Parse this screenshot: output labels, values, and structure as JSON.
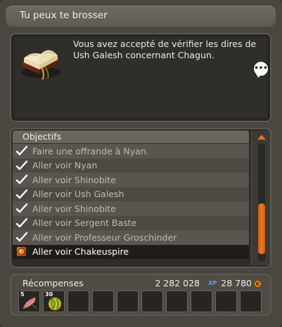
{
  "window": {
    "title": "Tu peux te brosser"
  },
  "description": {
    "text": "Vous avez accepté de vérifier les dires de Ush Galesh concernant Chagun.",
    "chat_bubble": "•••"
  },
  "objectives": {
    "header": "Objectifs",
    "items": [
      {
        "label": "Faire une offrande à Nyan.",
        "status": "done"
      },
      {
        "label": "Aller voir Nyan",
        "status": "done"
      },
      {
        "label": "Aller voir Shinobite",
        "status": "done"
      },
      {
        "label": "Aller voir Ush Galesh",
        "status": "done"
      },
      {
        "label": "Aller voir Shinobite",
        "status": "done"
      },
      {
        "label": "Aller voir Sergent Baste",
        "status": "done"
      },
      {
        "label": "Aller voir Professeur Groschinder",
        "status": "done"
      },
      {
        "label": "Aller voir Chakeuspire",
        "status": "active"
      }
    ]
  },
  "rewards": {
    "label": "Récompenses",
    "xp": "2 282 028",
    "xp_tag": "XP",
    "kamas": "28 780",
    "kama_symbol": "K",
    "items": [
      {
        "qty": "5",
        "icon": "pink-feather-icon"
      },
      {
        "qty": "30",
        "icon": "green-gem-icon"
      }
    ],
    "empty_slots": 8
  },
  "colors": {
    "accent_orange": "#e8711a",
    "xp_blue": "#4fa3e6"
  }
}
